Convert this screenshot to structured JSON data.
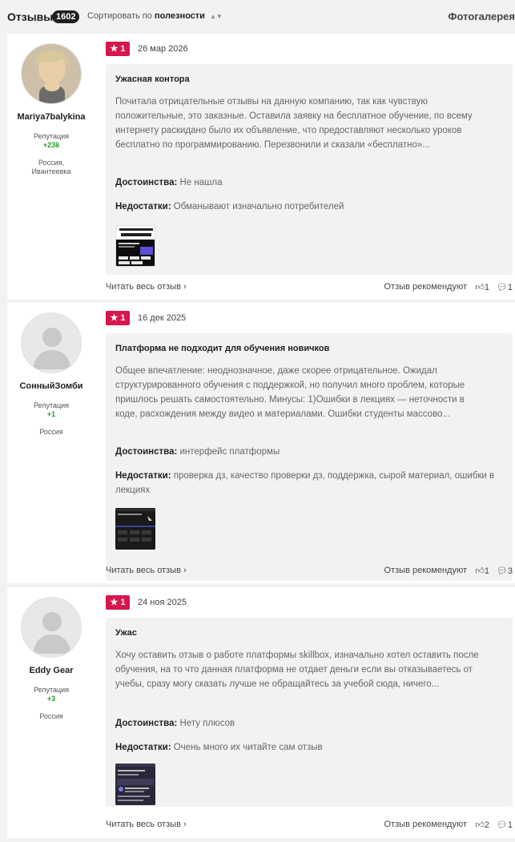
{
  "header": {
    "title": "Отзывы",
    "count": "1602",
    "sort_prefix": "Сортировать по",
    "sort_value": "полезности",
    "gallery_link": "Фотогалерея"
  },
  "reviews": [
    {
      "author": "Mariya7balykina",
      "reputation_label": "Репутация",
      "reputation": "+236",
      "location": "Россия, Ивантеевка",
      "rating": "1",
      "date": "26 мар 2026",
      "title": "Ужасная контора",
      "text": "Почитала отрицательные отзывы на данную компанию, так как чувствую положительные, это заказные. Оставила заявку на бесплатное обучение, по всему интернету раскидано было их объявление, что предоставляют несколько уроков бесплатно по программированию. Перезвонили и сказали «бесплатно»...",
      "pros_label": "Достоинства:",
      "pros": "Не нашла",
      "cons_label": "Недостатки:",
      "cons": "Обманывают изначально потребителей",
      "read_more": "Читать весь отзыв",
      "recommend_label": "Отзыв рекомендуют",
      "likes": "1",
      "comments": "1"
    },
    {
      "author": "СонныйЗомби",
      "reputation_label": "Репутация",
      "reputation": "+1",
      "location": "Россия",
      "rating": "1",
      "date": "16 дек 2025",
      "title": "Платформа не подходит для обучения новичков",
      "text": "Общее впечатление: неоднозначное, даже скорее отрицательное. Ожидал структурированного обучения с поддержкой, но получил много проблем, которые пришлось решать самостоятельно. Минусы: 1)Ошибки в лекциях — неточности в коде, расхождения между видео и материалами. Ошибки студенты массово...",
      "pros_label": "Достоинства:",
      "pros": "интерфейс платформы",
      "cons_label": "Недостатки:",
      "cons": "проверка дз, качество проверки дз, поддержка, сырой материал, ошибки в лекциях",
      "read_more": "Читать весь отзыв",
      "recommend_label": "Отзыв рекомендуют",
      "likes": "1",
      "comments": "3"
    },
    {
      "author": "Eddy Gear",
      "reputation_label": "Репутация",
      "reputation": "+3",
      "location": "Россия",
      "rating": "1",
      "date": "24 ноя 2025",
      "title": "Ужас",
      "text": "Хочу оставить отзыв о работе платформы skillbox, изначально хотел оставить после обучения, на то что данная платформа не отдает деньги если вы отказываетесь от учебы, сразу могу сказать лучше не обращайтесь за учебой сюда, ничего...",
      "pros_label": "Достоинства:",
      "pros": "Нету плюсов",
      "cons_label": "Недостатки:",
      "cons": "Очень много их читайте сам отзыв",
      "read_more": "Читать весь отзыв",
      "recommend_label": "Отзыв рекомендуют",
      "likes": "2",
      "comments": "1"
    }
  ]
}
